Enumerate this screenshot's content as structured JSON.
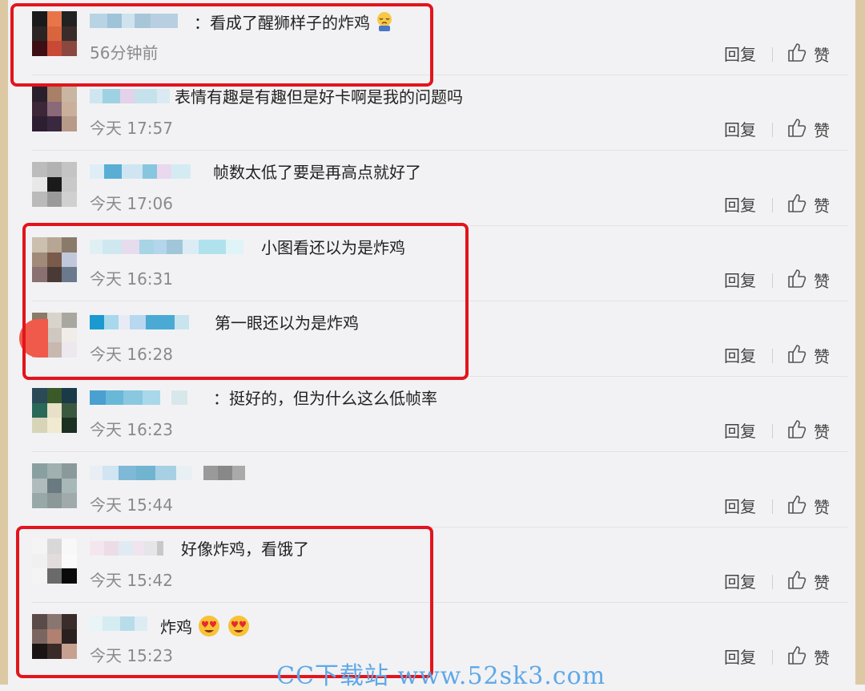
{
  "comments": [
    {
      "text": "：看成了醒狮样子的炸鸡",
      "time": "56分钟前",
      "reply": "回复",
      "like": "赞",
      "emoji_after": "sleepy-face"
    },
    {
      "text": "表情有趣是有趣但是好卡啊是我的问题吗",
      "time": "今天 17:57",
      "reply": "回复",
      "like": "赞"
    },
    {
      "text": "帧数太低了要是再高点就好了",
      "time": "今天 17:06",
      "reply": "回复",
      "like": "赞"
    },
    {
      "text": "小图看还以为是炸鸡",
      "time": "今天 16:31",
      "reply": "回复",
      "like": "赞"
    },
    {
      "text": "第一眼还以为是炸鸡",
      "time": "今天 16:28",
      "reply": "回复",
      "like": "赞"
    },
    {
      "text": "：挺好的，但为什么这么低帧率",
      "time": "今天 16:23",
      "reply": "回复",
      "like": "赞"
    },
    {
      "text": "",
      "time": "今天 15:44",
      "reply": "回复",
      "like": "赞"
    },
    {
      "text": "好像炸鸡，看饿了",
      "time": "今天 15:42",
      "reply": "回复",
      "like": "赞"
    },
    {
      "text": "炸鸡",
      "time": "今天 15:23",
      "reply": "回复",
      "like": "赞",
      "emoji_after": "heart-eyes-face x2"
    }
  ],
  "watermark": "CC下载站 www.52sk3.com",
  "colors": {
    "highlight": "#e3141c",
    "watermark": "#5fa8e8",
    "background": "#f2f2f4"
  }
}
